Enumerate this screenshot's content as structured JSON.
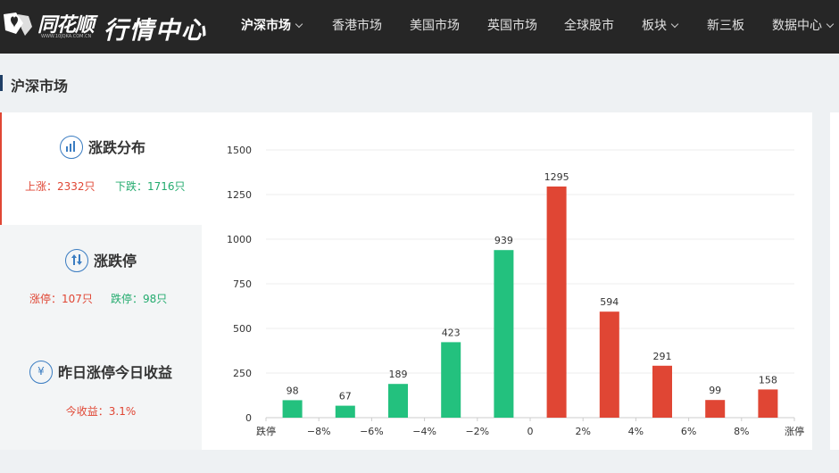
{
  "header": {
    "logo_text": "同花顺",
    "logo_url": "WWW.10JQKA.COM.CN",
    "title": "行情中心",
    "nav": [
      {
        "label": "沪深市场",
        "active": true,
        "dropdown": true
      },
      {
        "label": "香港市场",
        "active": false,
        "dropdown": false
      },
      {
        "label": "美国市场",
        "active": false,
        "dropdown": false
      },
      {
        "label": "英国市场",
        "active": false,
        "dropdown": false
      },
      {
        "label": "全球股市",
        "active": false,
        "dropdown": false
      },
      {
        "label": "板块",
        "active": false,
        "dropdown": true
      },
      {
        "label": "新三板",
        "active": false,
        "dropdown": false
      },
      {
        "label": "数据中心",
        "active": false,
        "dropdown": true
      }
    ]
  },
  "section": {
    "title": "沪深市场"
  },
  "panels": [
    {
      "title": "涨跌分布",
      "icon": "bar-chart-icon",
      "stats": [
        {
          "text": "上涨：2332只",
          "tone": "up"
        },
        {
          "text": "下跌：1716只",
          "tone": "down"
        }
      ]
    },
    {
      "title": "涨跌停",
      "icon": "up-down-arrows-icon",
      "stats": [
        {
          "text": "涨停：107只",
          "tone": "up"
        },
        {
          "text": "跌停：98只",
          "tone": "down"
        }
      ]
    },
    {
      "title": "昨日涨停今日收益",
      "icon": "yen-icon",
      "icon_glyph": "¥",
      "stats": [
        {
          "text": "今收益：3.1%",
          "tone": "up"
        }
      ]
    }
  ],
  "colors": {
    "up": "#e04634",
    "down": "#23c17e",
    "nav_bg": "#262626",
    "accent": "#3a7cc1"
  },
  "chart_data": {
    "type": "bar",
    "categories": [
      "跌停",
      "−8%~−6%",
      "−6%~−4%",
      "−4%~−2%",
      "−2%~0",
      "0~2%",
      "2%~4%",
      "4%~6%",
      "6%~8%",
      "涨停"
    ],
    "values": [
      98,
      67,
      189,
      423,
      939,
      1295,
      594,
      291,
      99,
      158
    ],
    "colors": [
      "down",
      "down",
      "down",
      "down",
      "down",
      "up",
      "up",
      "up",
      "up",
      "up"
    ],
    "x_tick_labels": [
      "跌停",
      "−8%",
      "−6%",
      "−4%",
      "−2%",
      "0",
      "2%",
      "4%",
      "6%",
      "8%",
      "涨停"
    ],
    "y_ticks": [
      0,
      250,
      500,
      750,
      1000,
      1250,
      1500
    ],
    "ylim": [
      0,
      1500
    ],
    "grid": true,
    "data_labels": true
  }
}
